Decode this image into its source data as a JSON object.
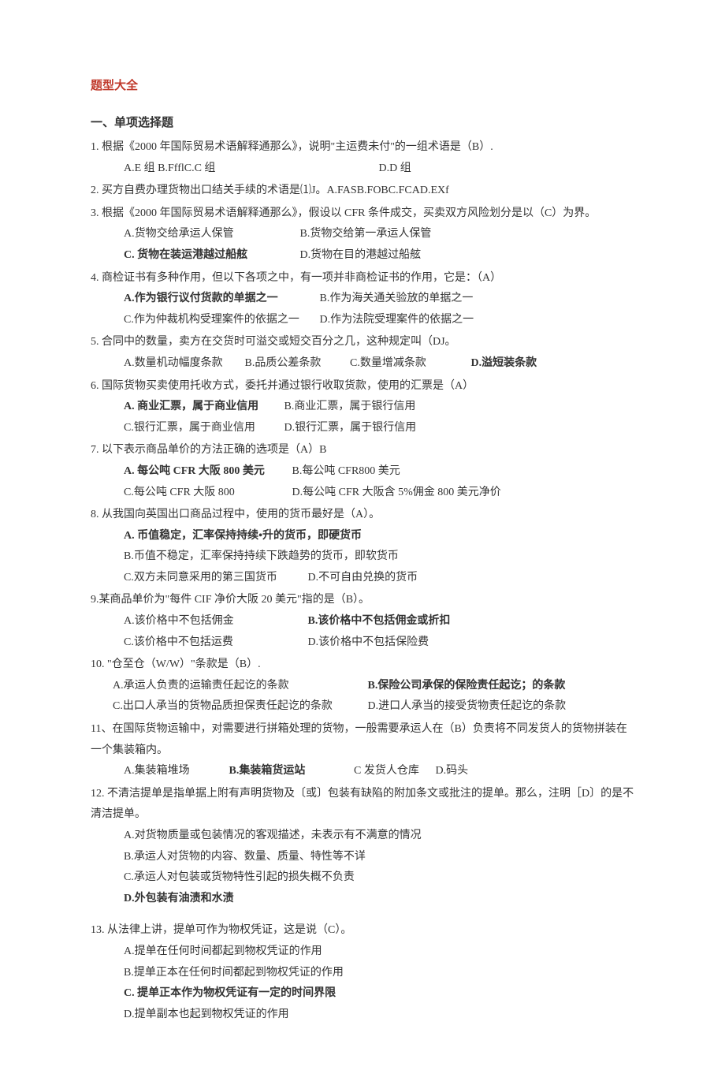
{
  "title": "题型大全",
  "section1": "一、单项选择题",
  "q1": {
    "stem": "1. 根据《2000 年国际贸易术语解释通那么》，说明\"主运费未付\"的一组术语是（B）.",
    "optA": "A.E 组 B.FfflC.C 组",
    "optD": "D.D 组"
  },
  "q2": {
    "stem": "2. 买方自费办理货物出口结关手续的术语是⑴J。A.FASB.FOBC.FCAD.EXf"
  },
  "q3": {
    "stem": "3. 根据《2000 年国际贸易术语解释通那么》，假设以 CFR 条件成交，买卖双方风险划分是以（C）为界。",
    "line1a": "A.货物交给承运人保管",
    "line1b": "B.货物交给第一承运人保管",
    "line2a": "C. 货物在装运港越过船舷",
    "line2b": "D.货物在目的港越过船舷"
  },
  "q4": {
    "stem": "4. 商检证书有多种作用，但以下各项之中，有一项并非商检证书的作用，它是：（A）",
    "line1a": "A.作为银行议付货款的单据之一",
    "line1b": "B.作为海关通关验放的单据之一",
    "line2a": "C.作为仲裁机构受理案件的依据之一",
    "line2b": "D.作为法院受理案件的依据之一"
  },
  "q5": {
    "stem": "5. 合同中的数量，卖方在交货时可溢交或短交百分之几，这种规定叫（DJ。",
    "a": "A.数量机动幅度条款",
    "b": "B.品质公差条款",
    "c": "C.数量增减条款",
    "d": "D.溢短装条款"
  },
  "q6": {
    "stem": "6. 国际货物买卖使用托收方式，委托并通过银行收取货款，使用的汇票是（A）",
    "line1a": "A. 商业汇票，属于商业信用",
    "line1b": "B.商业汇票，属于银行信用",
    "line2a": "C.银行汇票，属于商业信用",
    "line2b": "D.银行汇票，属于银行信用"
  },
  "q7": {
    "stem": "7. 以下表示商品单价的方法正确的选项是（A）B",
    "line1a": "A. 每公吨 CFR 大阪 800 美元",
    "line1b": "B.每公吨 CFR800 美元",
    "line2a": "C.每公吨 CFR 大阪 800",
    "line2b": "D.每公吨 CFR 大阪含 5%佣金 800 美元净价"
  },
  "q8": {
    "stem": "8. 从我国向英国出口商品过程中，使用的货币最好是（A）。",
    "a": "A. 币值稳定，汇率保持持续•升的货币，即硬货币",
    "b": "B.币值不稳定，汇率保持持续下跌趋势的货币，即软货币",
    "c1": "C.双方未同意采用的第三国货币",
    "c2": "D.不可自由兑换的货币"
  },
  "q9": {
    "stem": "9.某商品单价为\"每件 CIF 净价大阪 20 美元\"指的是（B）。",
    "line1a": "A.该价格中不包括佣金",
    "line1b": "B.该价格中不包括佣金或折扣",
    "line2a": "C.该价格中不包括运费",
    "line2b": "D.该价格中不包括保险费"
  },
  "q10": {
    "stem": "10. \"仓至仓（W/W）\"条款是（B）.",
    "line1a": "A.承运人负责的运输责任起讫的条款",
    "line1b": "B.保险公司承保的保险责任起讫；的条款",
    "line2a": "C.出口人承当的货物品质担保责任起讫的条款",
    "line2b": "D.进口人承当的接受货物责任起讫的条款"
  },
  "q11": {
    "stem": "11、在国际货物运输中，对需要进行拼箱处理的货物，一般需要承运人在（B）负责将不同发货人的货物拼装在一个集装箱内。",
    "a": "A.集装箱堆场",
    "b": "B.集装箱货运站",
    "c": "C 发货人仓库",
    "d": "D.码头"
  },
  "q12": {
    "stem": "12. 不清洁提单是指单据上附有声明货物及〔或〕包装有缺陷的附加条文或批注的提单。那么，注明［D〕的是不清洁提单。",
    "a": "A.对货物质量或包装情况的客观描述，未表示有不满意的情况",
    "b": "B.承运人对货物的内容、数量、质量、特性等不详",
    "c": "C.承运人对包装或货物特性引起的损失概不负责",
    "d": "D.外包装有油渍和水渍"
  },
  "q13": {
    "stem": "13. 从法律上讲，提单可作为物权凭证，这是说（C）。",
    "a": "A.提单在任何时间都起到物权凭证的作用",
    "b": "B.提单正本在任何时间都起到物权凭证的作用",
    "c": "C. 提单正本作为物权凭证有一定的时间界限",
    "d": "D.提单副本也起到物权凭证的作用"
  }
}
